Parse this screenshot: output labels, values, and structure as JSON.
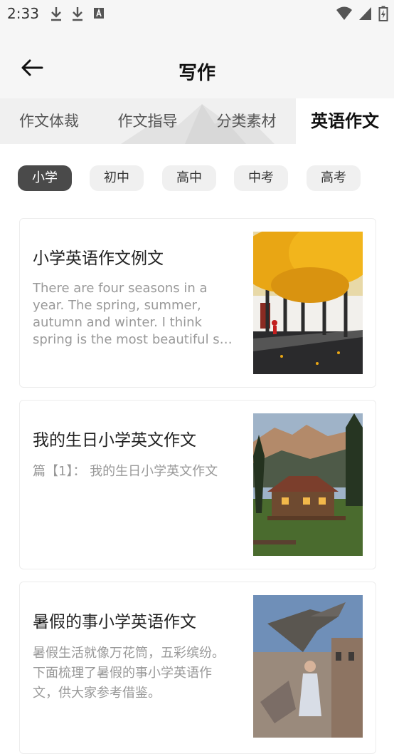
{
  "status_bar": {
    "time": "2:33"
  },
  "header": {
    "title": "写作"
  },
  "tabs": [
    {
      "label": "作文体裁"
    },
    {
      "label": "作文指导"
    },
    {
      "label": "分类素材"
    },
    {
      "label": "英语作文"
    }
  ],
  "chips": [
    {
      "label": "小学"
    },
    {
      "label": "初中"
    },
    {
      "label": "高中"
    },
    {
      "label": "中考"
    },
    {
      "label": "高考"
    }
  ],
  "articles": [
    {
      "title": "小学英语作文例文",
      "excerpt": "There are four seasons in a year. The spring, summer, autumn and winter. I think spring is the most beautiful s…",
      "thumbnail": "autumn-trees-street-photo"
    },
    {
      "title": "我的生日小学英文作文",
      "excerpt": "篇【1】：  我的生日小学英文作文",
      "thumbnail": "mountain-cabin-photo"
    },
    {
      "title": "暑假的事小学英语作文",
      "excerpt": "暑假生活就像万花筒，五彩缤纷。下面梳理了暑假的事小学英语作文，供大家参考借鉴。",
      "thumbnail": "birds-and-woman-photo"
    }
  ],
  "colors": {
    "active_chip": "#4a4a4a",
    "chip": "#f0f0f0",
    "tab_bar": "#f0f0f0",
    "header": "#f6f6f6"
  }
}
